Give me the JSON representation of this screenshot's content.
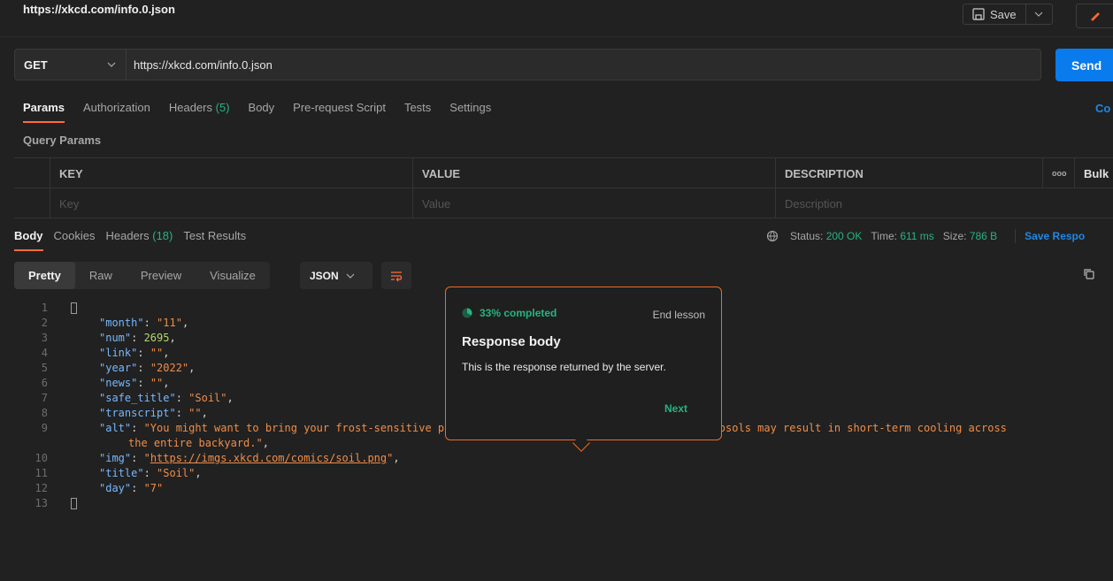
{
  "window": {
    "title": "https://xkcd.com/info.0.json"
  },
  "toolbar": {
    "save_label": "Save"
  },
  "request": {
    "method": "GET",
    "url": "https://xkcd.com/info.0.json",
    "send_label": "Send",
    "tabs": [
      {
        "label": "Params"
      },
      {
        "label": "Authorization"
      },
      {
        "label": "Headers",
        "count": "(5)"
      },
      {
        "label": "Body"
      },
      {
        "label": "Pre-request Script"
      },
      {
        "label": "Tests"
      },
      {
        "label": "Settings"
      }
    ],
    "cookies_label": "Co"
  },
  "query_params": {
    "title": "Query Params",
    "headers": {
      "key": "KEY",
      "value": "VALUE",
      "description": "DESCRIPTION",
      "more": "ooo",
      "bulk": "Bulk"
    },
    "placeholders": {
      "key": "Key",
      "value": "Value",
      "description": "Description"
    }
  },
  "response": {
    "tabs": [
      {
        "label": "Body"
      },
      {
        "label": "Cookies"
      },
      {
        "label": "Headers",
        "count": "(18)"
      },
      {
        "label": "Test Results"
      }
    ],
    "status_label": "Status:",
    "status_value": "200 OK",
    "time_label": "Time:",
    "time_value": "611 ms",
    "size_label": "Size:",
    "size_value": "786 B",
    "save_response": "Save Respo",
    "view_tabs": [
      {
        "label": "Pretty"
      },
      {
        "label": "Raw"
      },
      {
        "label": "Preview"
      },
      {
        "label": "Visualize"
      }
    ],
    "format": "JSON"
  },
  "code": {
    "line_numbers": [
      "1",
      "2",
      "3",
      "4",
      "5",
      "6",
      "7",
      "8",
      "9",
      "",
      "10",
      "11",
      "12",
      "13"
    ],
    "month_key": "\"month\"",
    "month_val": "\"11\"",
    "num_key": "\"num\"",
    "num_val": "2695",
    "link_key": "\"link\"",
    "link_val": "\"\"",
    "year_key": "\"year\"",
    "year_val": "\"2022\"",
    "news_key": "\"news\"",
    "news_val": "\"\"",
    "safe_title_key": "\"safe_title\"",
    "safe_title_val": "\"Soil\"",
    "transcript_key": "\"transcript\"",
    "transcript_val": "\"\"",
    "alt_key": "\"alt\"",
    "alt_val_1": "\"You might want to bring your frost-sensitive plants in from the patio. The high-level aerosols may result in short-term cooling across",
    "alt_val_2": "the entire backyard.\"",
    "img_key": "\"img\"",
    "img_val": "https://imgs.xkcd.com/comics/soil.png",
    "title_key": "\"title\"",
    "title_val": "\"Soil\"",
    "day_key": "\"day\"",
    "day_val": "\"7\""
  },
  "lesson": {
    "progress_label": "33% completed",
    "progress": 0.33,
    "end_label": "End lesson",
    "title": "Response body",
    "body": "This is the response returned by the server.",
    "next_label": "Next"
  },
  "colors": {
    "accent": "#ff6c37",
    "send": "#097bed",
    "success": "#26b47f",
    "link": "#1e88e5"
  }
}
